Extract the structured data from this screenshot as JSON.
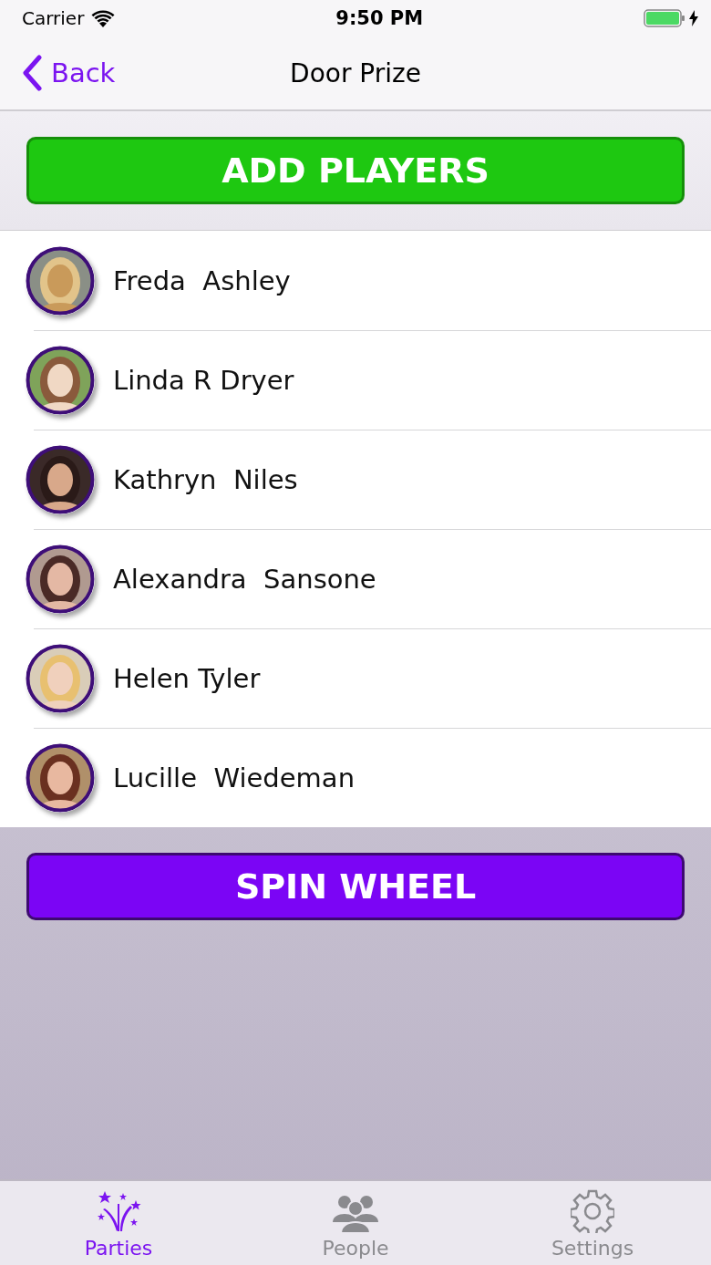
{
  "status_bar": {
    "carrier": "Carrier",
    "time": "9:50 PM",
    "charging": true
  },
  "nav": {
    "back": "Back",
    "title": "Door Prize"
  },
  "add_button": "ADD PLAYERS",
  "players": [
    {
      "name": "Freda  Ashley"
    },
    {
      "name": "Linda R Dryer"
    },
    {
      "name": "Kathryn  Niles"
    },
    {
      "name": "Alexandra  Sansone"
    },
    {
      "name": "Helen Tyler"
    },
    {
      "name": "Lucille  Wiedeman"
    }
  ],
  "spin_button": "SPIN WHEEL",
  "tabs": [
    {
      "label": "Parties",
      "kind": "fireworks",
      "selected": true
    },
    {
      "label": "People",
      "kind": "people",
      "selected": false
    },
    {
      "label": "Settings",
      "kind": "gear",
      "selected": false
    }
  ]
}
